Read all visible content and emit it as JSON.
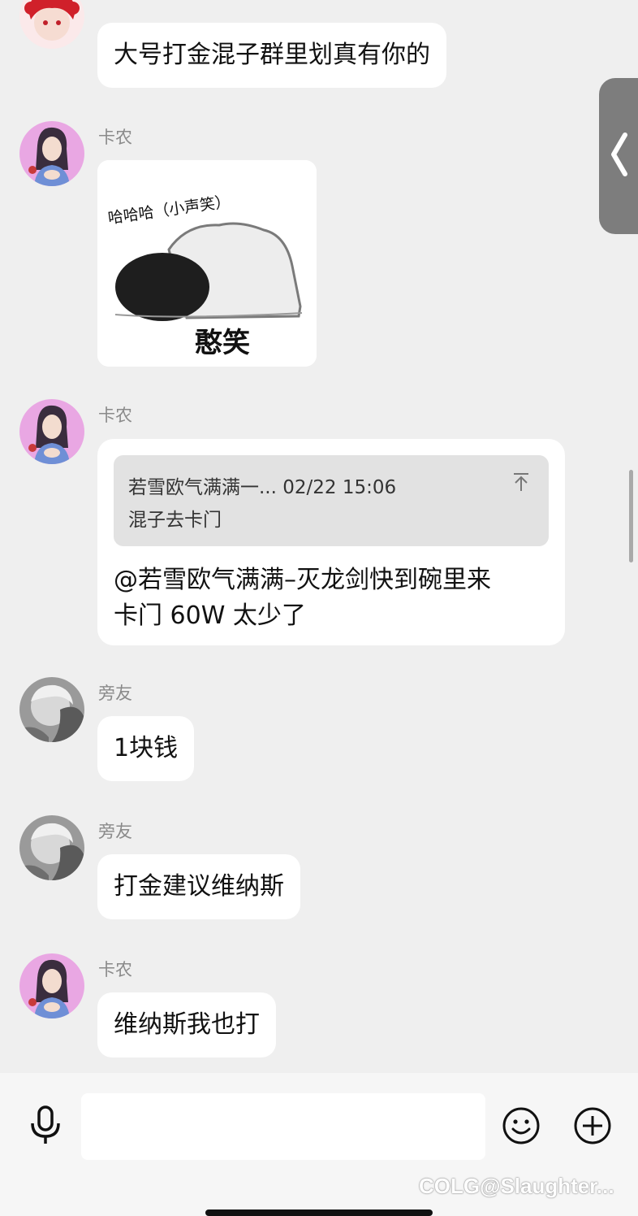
{
  "messages": [
    {
      "text": "大号打金混子群里划真有你的"
    },
    {
      "sender": "卡农",
      "image_caption": "哈哈哈（小声笑）",
      "image_label": "憨笑"
    },
    {
      "sender": "卡农",
      "quote": {
        "header": "若雪欧气满满一... 02/22 15:06",
        "body": "混子去卡门"
      },
      "text_line1": "@若雪欧气满满–灭龙剑快到碗里来",
      "text_line2": "卡门 60W 太少了"
    },
    {
      "sender": "旁友",
      "text": "1块钱"
    },
    {
      "sender": "旁友",
      "text": "打金建议维纳斯"
    },
    {
      "sender": "卡农",
      "text": "维纳斯我也打"
    }
  ],
  "input": {
    "placeholder": ""
  },
  "icons": {
    "mic": "microphone-icon",
    "emoji": "smiley-icon",
    "plus": "plus-circle-icon",
    "handle": "chevron-left-icon"
  },
  "watermark": "@Slaughter...",
  "watermark_logo": "COLG",
  "colors": {
    "background": "#efefef",
    "bubble": "#ffffff",
    "name": "#8a8a8a",
    "quote": "#e2e2e2"
  }
}
